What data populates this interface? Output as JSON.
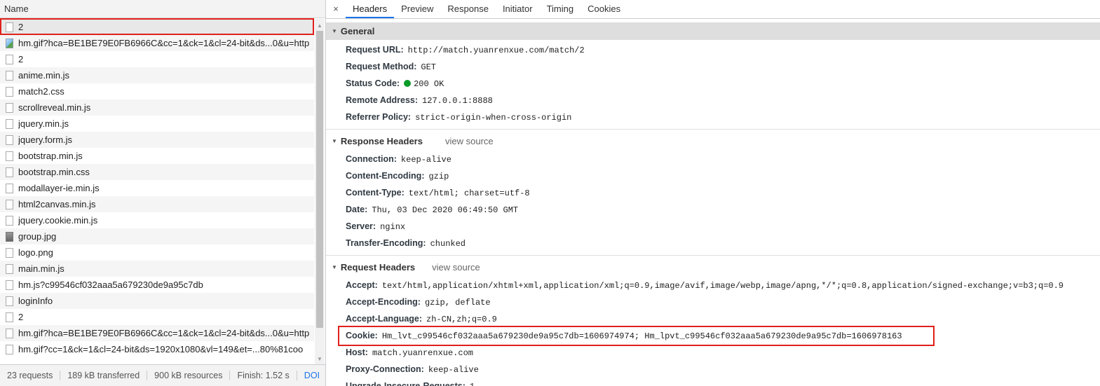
{
  "network": {
    "column_header": "Name",
    "items": [
      {
        "name": "2",
        "icon": "document-icon"
      },
      {
        "name": "hm.gif?hca=BE1BE79E0FB6966C&cc=1&ck=1&cl=24-bit&ds...0&u=http",
        "icon": "image-file-icon"
      },
      {
        "name": "2",
        "icon": "document-icon"
      },
      {
        "name": "anime.min.js",
        "icon": "document-icon"
      },
      {
        "name": "match2.css",
        "icon": "document-icon"
      },
      {
        "name": "scrollreveal.min.js",
        "icon": "document-icon"
      },
      {
        "name": "jquery.min.js",
        "icon": "document-icon"
      },
      {
        "name": "jquery.form.js",
        "icon": "document-icon"
      },
      {
        "name": "bootstrap.min.js",
        "icon": "document-icon"
      },
      {
        "name": "bootstrap.min.css",
        "icon": "document-icon"
      },
      {
        "name": "modallayer-ie.min.js",
        "icon": "document-icon"
      },
      {
        "name": "html2canvas.min.js",
        "icon": "document-icon"
      },
      {
        "name": "jquery.cookie.min.js",
        "icon": "document-icon"
      },
      {
        "name": "group.jpg",
        "icon": "jpg-file-icon"
      },
      {
        "name": "logo.png",
        "icon": "document-icon"
      },
      {
        "name": "main.min.js",
        "icon": "document-icon"
      },
      {
        "name": "hm.js?c99546cf032aaa5a679230de9a95c7db",
        "icon": "document-icon"
      },
      {
        "name": "loginInfo",
        "icon": "document-icon"
      },
      {
        "name": "2",
        "icon": "document-icon"
      },
      {
        "name": "hm.gif?hca=BE1BE79E0FB6966C&cc=1&ck=1&cl=24-bit&ds...0&u=http",
        "icon": "document-icon"
      },
      {
        "name": "hm.gif?cc=1&ck=1&cl=24-bit&ds=1920x1080&vl=149&et=...80%81coo",
        "icon": "document-icon"
      }
    ],
    "status": {
      "requests": "23 requests",
      "transferred": "189 kB transferred",
      "resources": "900 kB resources",
      "finish": "Finish: 1.52 s",
      "dom": "DOI"
    }
  },
  "tabs": {
    "close": "×",
    "items": [
      "Headers",
      "Preview",
      "Response",
      "Initiator",
      "Timing",
      "Cookies"
    ],
    "active": "Headers"
  },
  "general": {
    "title": "General",
    "rows": [
      {
        "key": "Request URL:",
        "value": "http://match.yuanrenxue.com/match/2"
      },
      {
        "key": "Request Method:",
        "value": "GET"
      },
      {
        "key": "Status Code:",
        "value": "200 OK"
      },
      {
        "key": "Remote Address:",
        "value": "127.0.0.1:8888"
      },
      {
        "key": "Referrer Policy:",
        "value": "strict-origin-when-cross-origin"
      }
    ]
  },
  "response_headers": {
    "title": "Response Headers",
    "view_source": "view source",
    "rows": [
      {
        "key": "Connection:",
        "value": "keep-alive"
      },
      {
        "key": "Content-Encoding:",
        "value": "gzip"
      },
      {
        "key": "Content-Type:",
        "value": "text/html; charset=utf-8"
      },
      {
        "key": "Date:",
        "value": "Thu, 03 Dec 2020 06:49:50 GMT"
      },
      {
        "key": "Server:",
        "value": "nginx"
      },
      {
        "key": "Transfer-Encoding:",
        "value": "chunked"
      }
    ]
  },
  "request_headers": {
    "title": "Request Headers",
    "view_source": "view source",
    "rows": [
      {
        "key": "Accept:",
        "value": "text/html,application/xhtml+xml,application/xml;q=0.9,image/avif,image/webp,image/apng,*/*;q=0.8,application/signed-exchange;v=b3;q=0.9"
      },
      {
        "key": "Accept-Encoding:",
        "value": "gzip, deflate"
      },
      {
        "key": "Accept-Language:",
        "value": "zh-CN,zh;q=0.9"
      },
      {
        "key": "Cookie:",
        "value": "Hm_lvt_c99546cf032aaa5a679230de9a95c7db=1606974974; Hm_lpvt_c99546cf032aaa5a679230de9a95c7db=1606978163"
      },
      {
        "key": "Host:",
        "value": "match.yuanrenxue.com"
      },
      {
        "key": "Proxy-Connection:",
        "value": "keep-alive"
      },
      {
        "key": "Upgrade-Insecure-Requests:",
        "value": "1"
      }
    ]
  },
  "colors": {
    "accent": "#1a73e8",
    "highlight": "#e0201b",
    "status_ok": "#0a9b28"
  }
}
